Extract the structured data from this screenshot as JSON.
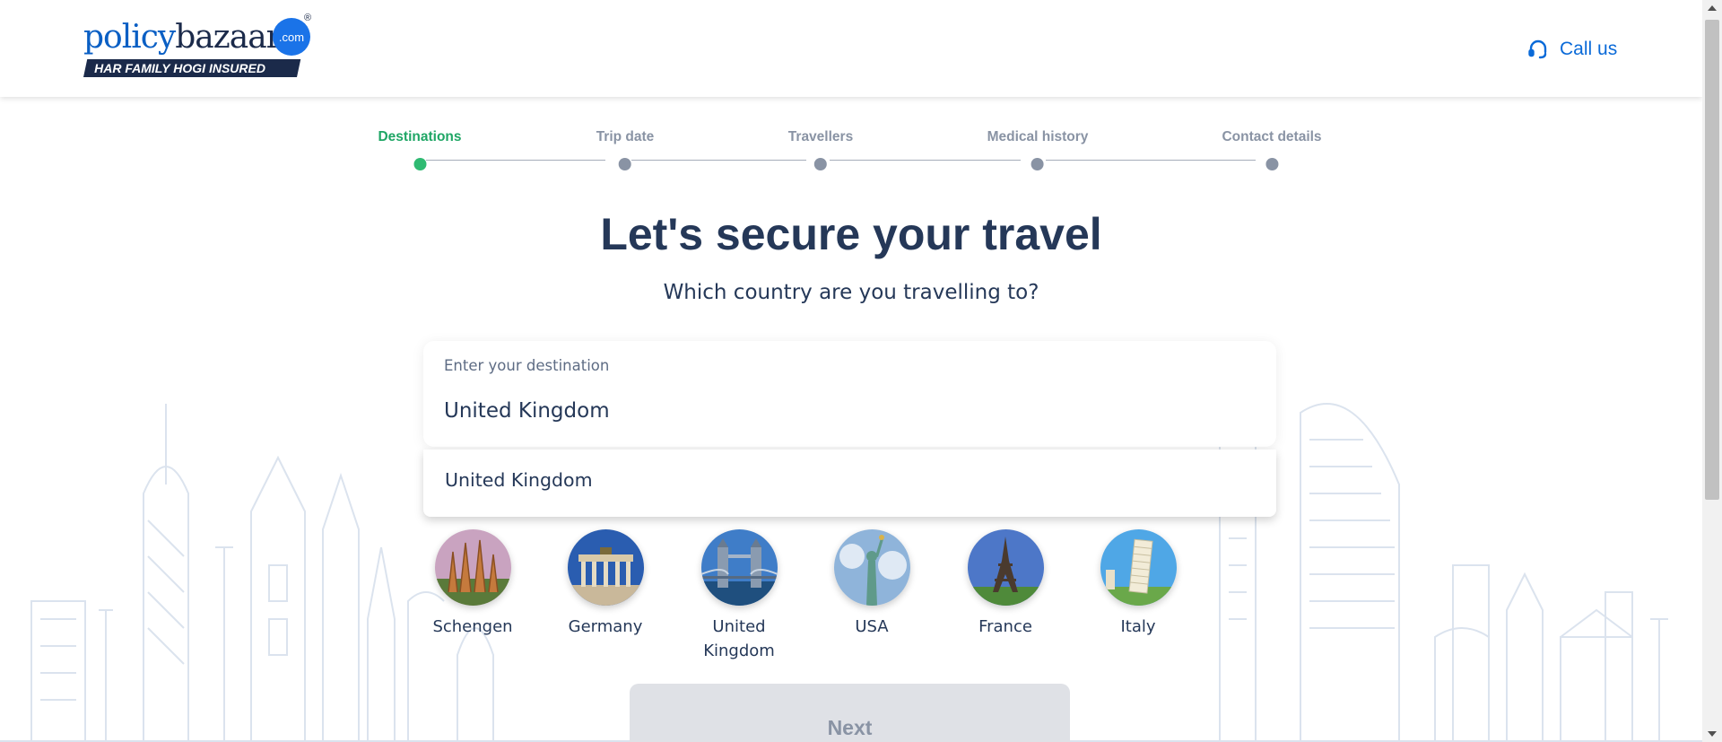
{
  "header": {
    "logo": {
      "word_part1": "policy",
      "word_part2": "bazaar",
      "dot": ".com",
      "registered": "®",
      "tagline": "HAR FAMILY HOGI INSURED"
    },
    "call_us_label": "Call us"
  },
  "stepper": {
    "steps": [
      {
        "label": "Destinations",
        "state": "active"
      },
      {
        "label": "Trip date",
        "state": "pending"
      },
      {
        "label": "Travellers",
        "state": "pending"
      },
      {
        "label": "Medical history",
        "state": "pending"
      },
      {
        "label": "Contact details",
        "state": "pending"
      }
    ]
  },
  "main": {
    "title": "Let's secure your travel",
    "subtitle": "Which country are you travelling to?"
  },
  "destination_input": {
    "label": "Enter your destination",
    "value": "United Kingdom"
  },
  "suggestions": [
    "United Kingdom"
  ],
  "countries": [
    {
      "name": "Schengen",
      "icon": "sagrada-familia-icon"
    },
    {
      "name": "Germany",
      "icon": "brandenburg-gate-icon"
    },
    {
      "name": "United Kingdom",
      "icon": "tower-bridge-icon"
    },
    {
      "name": "USA",
      "icon": "statue-of-liberty-icon"
    },
    {
      "name": "France",
      "icon": "eiffel-tower-icon"
    },
    {
      "name": "Italy",
      "icon": "leaning-tower-icon"
    }
  ],
  "next_button_label": "Next",
  "colors": {
    "brand_blue": "#0a6ad8",
    "active_step": "#2fba72",
    "text_dark": "#253858",
    "muted": "#8993a4",
    "disabled_button": "#dfe1e6"
  }
}
